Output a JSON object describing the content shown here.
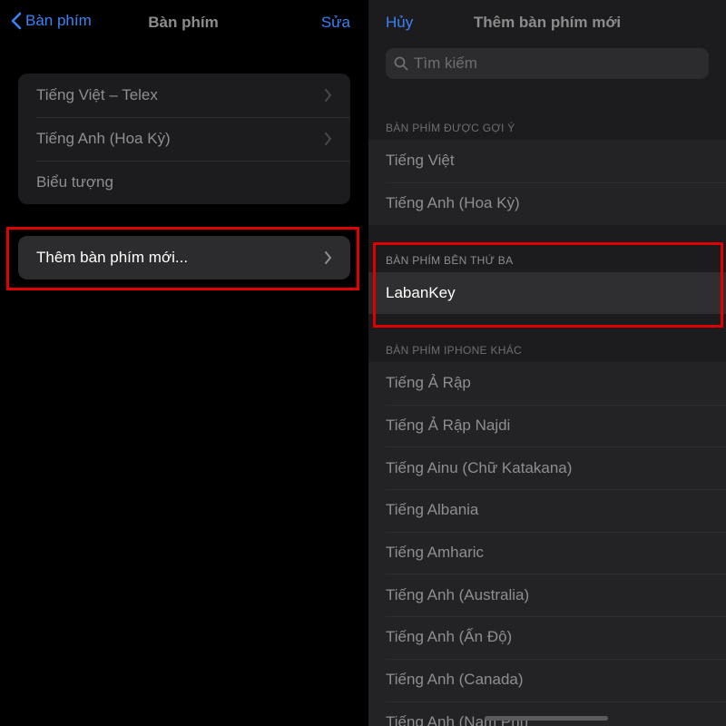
{
  "left": {
    "nav": {
      "back_label": "Bàn phím",
      "title": "Bàn phím",
      "edit_label": "Sửa"
    },
    "keyboards": [
      {
        "label": "Tiếng Việt – Telex",
        "chevron": true
      },
      {
        "label": "Tiếng Anh (Hoa Kỳ)",
        "chevron": true
      },
      {
        "label": "Biểu tượng",
        "chevron": false
      }
    ],
    "add_keyboard_label": "Thêm bàn phím mới..."
  },
  "right": {
    "nav": {
      "cancel_label": "Hủy",
      "title": "Thêm bàn phím mới"
    },
    "search": {
      "placeholder": "Tìm kiếm"
    },
    "suggested": {
      "header": "BÀN PHÍM ĐƯỢC GỢI Ý",
      "items": [
        "Tiếng Việt",
        "Tiếng Anh (Hoa Kỳ)"
      ]
    },
    "third_party": {
      "header": "BÀN PHÍM BÊN THỨ BA",
      "items": [
        "LabanKey"
      ]
    },
    "other": {
      "header": "BÀN PHÍM IPHONE KHÁC",
      "items": [
        "Tiếng Ả Rập",
        "Tiếng Ả Rập Najdi",
        "Tiếng Ainu (Chữ Katakana)",
        "Tiếng Albania",
        "Tiếng Amharic",
        "Tiếng Anh (Australia)",
        "Tiếng Anh (Ấn Độ)",
        "Tiếng Anh (Canada)",
        "Tiếng Anh (Nam Phi)"
      ]
    }
  },
  "colors": {
    "accent": "#3a82f7",
    "highlight": "#e00000"
  }
}
